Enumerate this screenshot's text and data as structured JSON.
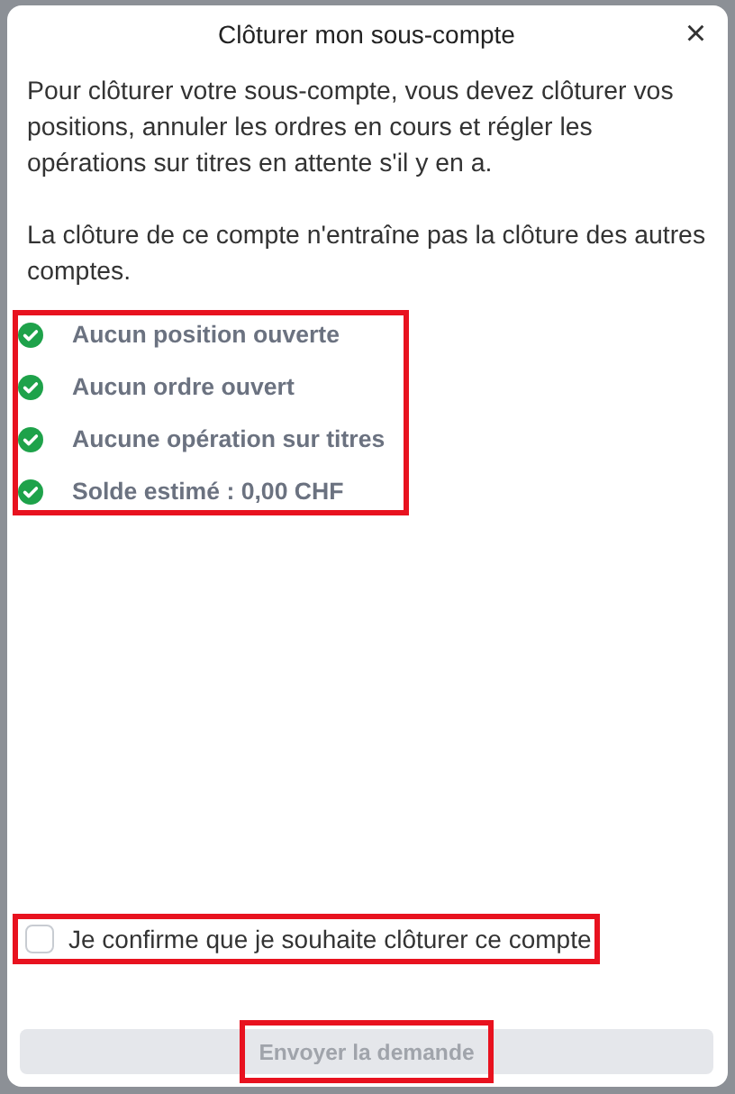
{
  "dialog": {
    "title": "Clôturer mon sous-compte",
    "close": "×"
  },
  "paragraphs": [
    "Pour clôturer votre sous-compte, vous devez clôturer vos positions, annuler les ordres en cours et régler les opérations sur titres en attente s'il y en a.",
    "La clôture de ce compte n'entraîne pas la clôture des autres comptes."
  ],
  "checks": {
    "highlighted": true,
    "items": [
      {
        "label": "Aucun position ouverte",
        "done": true
      },
      {
        "label": "Aucun ordre ouvert",
        "done": true
      },
      {
        "label": "Aucune opération sur titres",
        "done": true
      },
      {
        "label": "Solde estimé : 0,00 CHF",
        "done": true
      }
    ]
  },
  "confirm": {
    "label": "Je confirme que je souhaite clôturer ce compte",
    "checked": false,
    "highlighted": true
  },
  "submit": {
    "label": "Envoyer la demande",
    "disabled": true,
    "highlighted": true
  }
}
